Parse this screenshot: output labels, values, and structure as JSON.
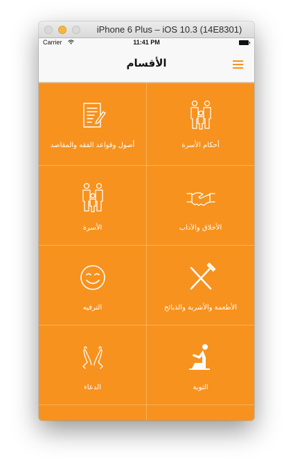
{
  "window": {
    "title": "iPhone 6 Plus – iOS 10.3 (14E8301)"
  },
  "status_bar": {
    "carrier": "Carrier",
    "time": "11:41 PM"
  },
  "nav": {
    "title": "الأقسام"
  },
  "categories": [
    {
      "label": "أحكام الأسرة",
      "icon": "family-icon"
    },
    {
      "label": "أصول وقواعد الفقه والمقاصد",
      "icon": "document-pen-icon"
    },
    {
      "label": "الأخلاق والآداب",
      "icon": "handshake-icon"
    },
    {
      "label": "الأسرة",
      "icon": "family-icon"
    },
    {
      "label": "الأطعمة والأشربة والذبائح",
      "icon": "fork-knife-icon"
    },
    {
      "label": "الترفيه",
      "icon": "smiley-icon"
    },
    {
      "label": "التوبة",
      "icon": "kneeling-prayer-icon"
    },
    {
      "label": "الدعاء",
      "icon": "praying-hands-icon"
    }
  ],
  "colors": {
    "accent": "#f7921e",
    "nav_background": "#f8f8f8"
  }
}
